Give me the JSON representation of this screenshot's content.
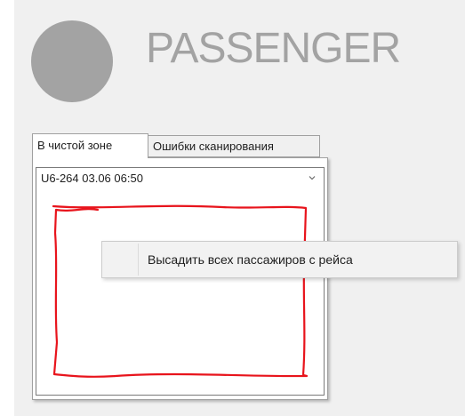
{
  "app": {
    "brand_title": "PASSENGER"
  },
  "tabs": [
    {
      "label": "В чистой зоне",
      "active": true
    },
    {
      "label": "Ошибки сканирования",
      "active": false
    }
  ],
  "flight_select": {
    "selected_value": "U6-264 03.06 06:50"
  },
  "context_menu": {
    "items": [
      {
        "label": "Высадить всех пассажиров с рейса"
      }
    ]
  },
  "colors": {
    "brand_gray": "#a3a3a3",
    "panel_bg": "#f0f0f0",
    "annotation_red": "#e8141c"
  },
  "icons": {
    "avatar": "avatar-circle",
    "combo_arrow": "chevron-down-icon"
  }
}
